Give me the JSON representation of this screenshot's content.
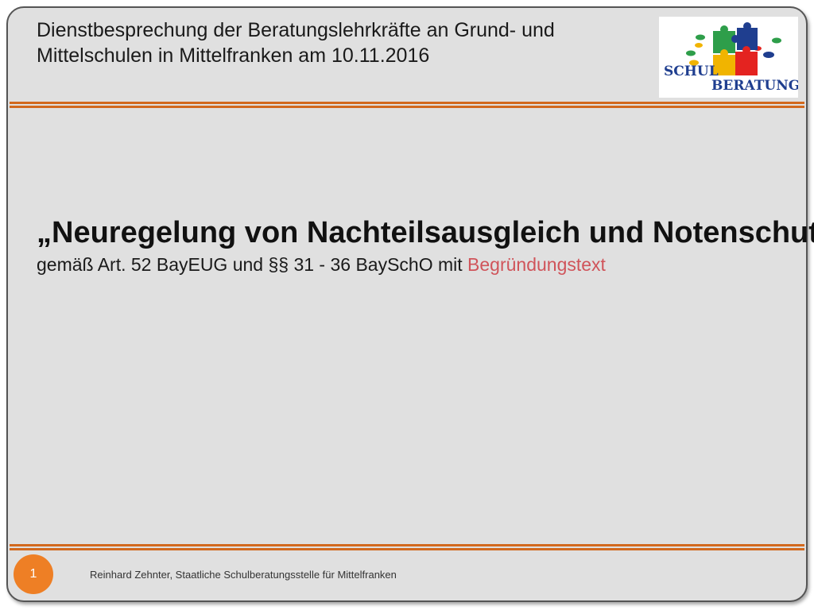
{
  "header": {
    "title": "Dienstbesprechung der Beratungslehrkräfte an Grund- und\nMittelschulen in Mittelfranken am 10.11.2016"
  },
  "logo": {
    "text_line1": "SCHUL",
    "text_line2": "BERATUNG"
  },
  "main": {
    "heading": "„Neuregelung von Nachteilsausgleich und Notenschutz“",
    "subtitle_prefix": "gemäß Art. 52 BayEUG und §§ 31 - 36  BaySchO mit ",
    "subtitle_link": "Begründungstext"
  },
  "footer": {
    "page_number": "1",
    "author_text": "Reinhard Zehnter, Staatliche Schulberatungsstelle für Mittelfranken"
  },
  "colors": {
    "accent_orange": "#ee7f25",
    "separator_orange": "#d2691e",
    "link_red": "#d0545a",
    "slide_background": "#e0e0e0"
  }
}
